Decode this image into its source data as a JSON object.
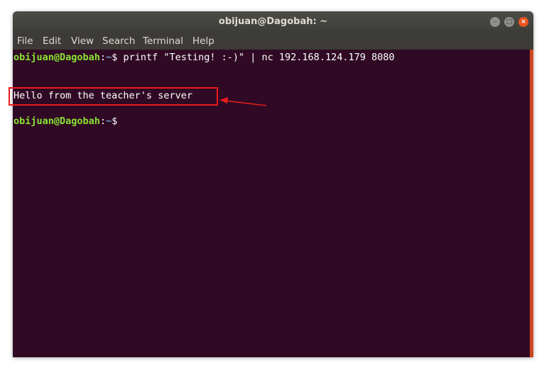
{
  "window": {
    "title": "obijuan@Dagobah: ~",
    "controls": {
      "minimize": "–",
      "maximize": "□",
      "close": "×"
    }
  },
  "menubar": {
    "items": [
      "File",
      "Edit",
      "View",
      "Search",
      "Terminal",
      "Help"
    ]
  },
  "terminal": {
    "lines": [
      {
        "user": "obijuan@Dagobah",
        "sep": ":",
        "path": "~",
        "prompt": "$",
        "command": " printf \"Testing! :-)\" | nc 192.168.124.179 8080"
      },
      {
        "output": "Hello from the teacher's server"
      },
      {
        "user": "obijuan@Dagobah",
        "sep": ":",
        "path": "~",
        "prompt": "$",
        "command": ""
      }
    ]
  },
  "colors": {
    "terminal_bg": "#300a24",
    "user": "#8ae234",
    "path": "#729fcf",
    "annotation": "#e81c1c",
    "accent": "#e95420"
  },
  "icons": {
    "minimize": "minimize-icon",
    "maximize": "maximize-icon",
    "close": "close-icon",
    "annotation_arrow": "arrow-left-icon"
  }
}
